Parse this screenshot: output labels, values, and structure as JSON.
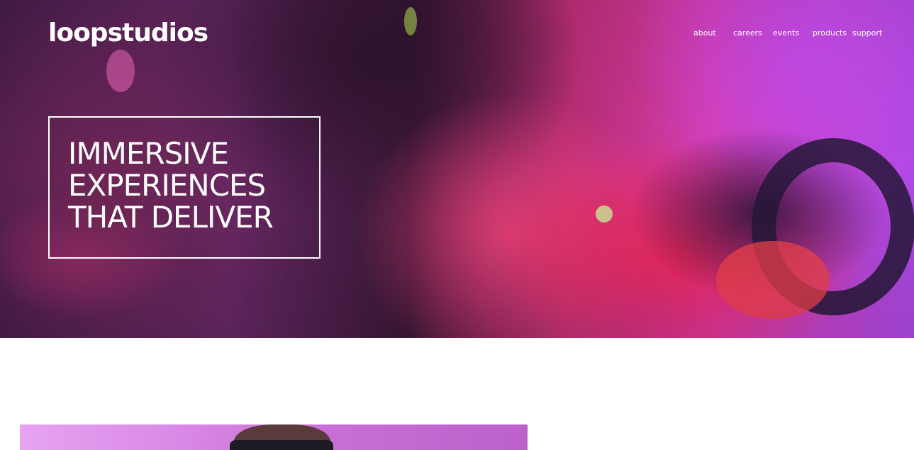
{
  "brand": {
    "logo_text": "loopstudios"
  },
  "nav": {
    "items": [
      {
        "label": "about"
      },
      {
        "label": "careers"
      },
      {
        "label": "events"
      },
      {
        "label": "products"
      },
      {
        "label": "support"
      }
    ]
  },
  "hero": {
    "headline_lines": [
      "IMMERSIVE",
      "EXPERIENCES",
      "THAT DELIVER"
    ]
  },
  "colors": {
    "text": "#ffffff",
    "background": "#ffffff",
    "hero_pink": "#e53fb5",
    "hero_violet": "#b54df0",
    "feature_tint": "#d98ae6"
  },
  "icons": []
}
